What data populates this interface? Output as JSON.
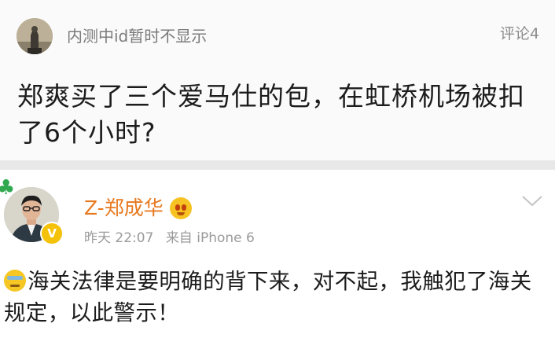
{
  "question_card": {
    "poster_name": "内测中id暂时不显示",
    "comment_count": "评论4",
    "question": "郑爽买了三个爱马仕的包，在虹桥机场被扣了6个小时?"
  },
  "answer_card": {
    "author_name": "Z-郑成华",
    "time": "昨天 22:07",
    "source": "来自 iPhone 6",
    "vip_badge": "V",
    "content": "海关法律是要明确的背下来，对不起，我触犯了海关规定，以此警示！"
  },
  "colors": {
    "author_name": "#e8791f",
    "vip_badge": "#f5c20b",
    "divider": "#e8e8e8"
  },
  "icons": {
    "top_avatar": "statue-avatar",
    "bottom_avatar": "man-avatar",
    "face_emoji": "grimace-emoji-icon",
    "sweat_emoji": "sweat-smile-emoji-icon",
    "collapse": "chevron-down-icon",
    "decoration": "clover-icon"
  }
}
